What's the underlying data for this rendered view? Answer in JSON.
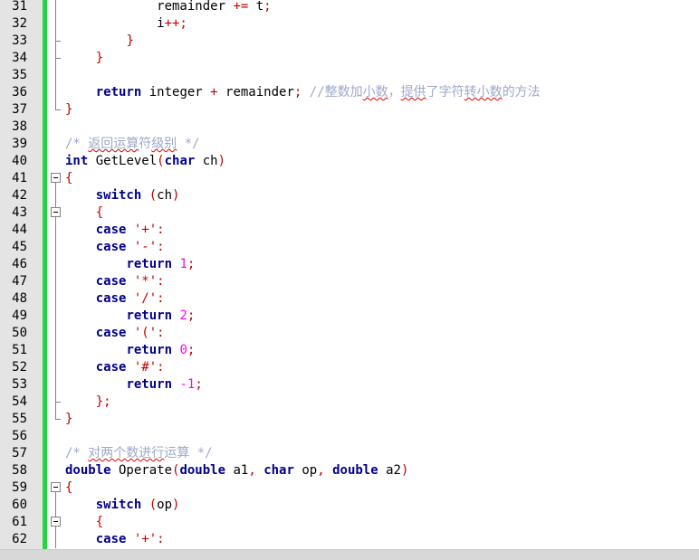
{
  "colors": {
    "gutter_bg": "#e4e4e4",
    "change_bar": "#22d63c",
    "keyword": "#00008b",
    "number": "#ff00ff",
    "string": "#c00000",
    "operator": "#c00000",
    "comment": "#9ea8c8"
  },
  "lines": [
    {
      "num": "31",
      "fold": "line",
      "tokens": [
        {
          "t": "plain",
          "v": "            remainder "
        },
        {
          "t": "operator",
          "v": "+="
        },
        {
          "t": "plain",
          "v": " t"
        },
        {
          "t": "operator",
          "v": ";"
        }
      ]
    },
    {
      "num": "32",
      "fold": "line",
      "tokens": [
        {
          "t": "plain",
          "v": "            i"
        },
        {
          "t": "operator",
          "v": "++;"
        }
      ]
    },
    {
      "num": "33",
      "fold": "end",
      "tokens": [
        {
          "t": "plain",
          "v": "        "
        },
        {
          "t": "operator",
          "v": "}"
        }
      ]
    },
    {
      "num": "34",
      "fold": "end",
      "tokens": [
        {
          "t": "plain",
          "v": "    "
        },
        {
          "t": "operator",
          "v": "}"
        }
      ]
    },
    {
      "num": "35",
      "fold": "line",
      "tokens": []
    },
    {
      "num": "36",
      "fold": "line",
      "tokens": [
        {
          "t": "plain",
          "v": "    "
        },
        {
          "t": "keyword",
          "v": "return"
        },
        {
          "t": "plain",
          "v": " integer "
        },
        {
          "t": "operator",
          "v": "+"
        },
        {
          "t": "plain",
          "v": " remainder"
        },
        {
          "t": "operator",
          "v": ";"
        },
        {
          "t": "plain",
          "v": " "
        },
        {
          "t": "comment",
          "v": "//整数加"
        },
        {
          "t": "squiggle",
          "v": "小数"
        },
        {
          "t": "comment",
          "v": "，"
        },
        {
          "t": "squiggle",
          "v": "提供"
        },
        {
          "t": "comment",
          "v": "了字符"
        },
        {
          "t": "squiggle",
          "v": "转小数"
        },
        {
          "t": "comment",
          "v": "的方法"
        }
      ]
    },
    {
      "num": "37",
      "fold": "last",
      "tokens": [
        {
          "t": "operator",
          "v": "}"
        }
      ]
    },
    {
      "num": "38",
      "fold": "none",
      "tokens": []
    },
    {
      "num": "39",
      "fold": "none",
      "tokens": [
        {
          "t": "comment",
          "v": "/* "
        },
        {
          "t": "squiggle",
          "v": "返回运算"
        },
        {
          "t": "comment",
          "v": "符"
        },
        {
          "t": "squiggle",
          "v": "级别"
        },
        {
          "t": "comment",
          "v": " */"
        }
      ]
    },
    {
      "num": "40",
      "fold": "none",
      "tokens": [
        {
          "t": "keyword",
          "v": "int"
        },
        {
          "t": "plain",
          "v": " GetLevel"
        },
        {
          "t": "operator",
          "v": "("
        },
        {
          "t": "keyword",
          "v": "char"
        },
        {
          "t": "plain",
          "v": " ch"
        },
        {
          "t": "operator",
          "v": ")"
        }
      ]
    },
    {
      "num": "41",
      "fold": "open",
      "tokens": [
        {
          "t": "operator",
          "v": "{"
        }
      ]
    },
    {
      "num": "42",
      "fold": "line",
      "tokens": [
        {
          "t": "plain",
          "v": "    "
        },
        {
          "t": "keyword",
          "v": "switch"
        },
        {
          "t": "plain",
          "v": " "
        },
        {
          "t": "operator",
          "v": "("
        },
        {
          "t": "plain",
          "v": "ch"
        },
        {
          "t": "operator",
          "v": ")"
        }
      ]
    },
    {
      "num": "43",
      "fold": "open-inner",
      "tokens": [
        {
          "t": "plain",
          "v": "    "
        },
        {
          "t": "operator",
          "v": "{"
        }
      ]
    },
    {
      "num": "44",
      "fold": "line",
      "tokens": [
        {
          "t": "plain",
          "v": "    "
        },
        {
          "t": "keyword",
          "v": "case"
        },
        {
          "t": "plain",
          "v": " "
        },
        {
          "t": "string",
          "v": "'+'"
        },
        {
          "t": "operator",
          "v": ":"
        }
      ]
    },
    {
      "num": "45",
      "fold": "line",
      "tokens": [
        {
          "t": "plain",
          "v": "    "
        },
        {
          "t": "keyword",
          "v": "case"
        },
        {
          "t": "plain",
          "v": " "
        },
        {
          "t": "string",
          "v": "'-'"
        },
        {
          "t": "operator",
          "v": ":"
        }
      ]
    },
    {
      "num": "46",
      "fold": "line",
      "tokens": [
        {
          "t": "plain",
          "v": "        "
        },
        {
          "t": "keyword",
          "v": "return"
        },
        {
          "t": "plain",
          "v": " "
        },
        {
          "t": "number",
          "v": "1"
        },
        {
          "t": "operator",
          "v": ";"
        }
      ]
    },
    {
      "num": "47",
      "fold": "line",
      "tokens": [
        {
          "t": "plain",
          "v": "    "
        },
        {
          "t": "keyword",
          "v": "case"
        },
        {
          "t": "plain",
          "v": " "
        },
        {
          "t": "string",
          "v": "'*'"
        },
        {
          "t": "operator",
          "v": ":"
        }
      ]
    },
    {
      "num": "48",
      "fold": "line",
      "tokens": [
        {
          "t": "plain",
          "v": "    "
        },
        {
          "t": "keyword",
          "v": "case"
        },
        {
          "t": "plain",
          "v": " "
        },
        {
          "t": "string",
          "v": "'/'"
        },
        {
          "t": "operator",
          "v": ":"
        }
      ]
    },
    {
      "num": "49",
      "fold": "line",
      "tokens": [
        {
          "t": "plain",
          "v": "        "
        },
        {
          "t": "keyword",
          "v": "return"
        },
        {
          "t": "plain",
          "v": " "
        },
        {
          "t": "number",
          "v": "2"
        },
        {
          "t": "operator",
          "v": ";"
        }
      ]
    },
    {
      "num": "50",
      "fold": "line",
      "tokens": [
        {
          "t": "plain",
          "v": "    "
        },
        {
          "t": "keyword",
          "v": "case"
        },
        {
          "t": "plain",
          "v": " "
        },
        {
          "t": "string",
          "v": "'('"
        },
        {
          "t": "operator",
          "v": ":"
        }
      ]
    },
    {
      "num": "51",
      "fold": "line",
      "tokens": [
        {
          "t": "plain",
          "v": "        "
        },
        {
          "t": "keyword",
          "v": "return"
        },
        {
          "t": "plain",
          "v": " "
        },
        {
          "t": "number",
          "v": "0"
        },
        {
          "t": "operator",
          "v": ";"
        }
      ]
    },
    {
      "num": "52",
      "fold": "line",
      "tokens": [
        {
          "t": "plain",
          "v": "    "
        },
        {
          "t": "keyword",
          "v": "case"
        },
        {
          "t": "plain",
          "v": " "
        },
        {
          "t": "string",
          "v": "'#'"
        },
        {
          "t": "operator",
          "v": ":"
        }
      ]
    },
    {
      "num": "53",
      "fold": "line",
      "tokens": [
        {
          "t": "plain",
          "v": "        "
        },
        {
          "t": "keyword",
          "v": "return"
        },
        {
          "t": "plain",
          "v": " "
        },
        {
          "t": "number",
          "v": "-1"
        },
        {
          "t": "operator",
          "v": ";"
        }
      ]
    },
    {
      "num": "54",
      "fold": "end",
      "tokens": [
        {
          "t": "plain",
          "v": "    "
        },
        {
          "t": "operator",
          "v": "};"
        }
      ]
    },
    {
      "num": "55",
      "fold": "last",
      "tokens": [
        {
          "t": "operator",
          "v": "}"
        }
      ]
    },
    {
      "num": "56",
      "fold": "none",
      "tokens": []
    },
    {
      "num": "57",
      "fold": "none",
      "tokens": [
        {
          "t": "comment",
          "v": "/* "
        },
        {
          "t": "squiggle",
          "v": "对两个数进行"
        },
        {
          "t": "comment",
          "v": "运算 */"
        }
      ]
    },
    {
      "num": "58",
      "fold": "none",
      "tokens": [
        {
          "t": "keyword",
          "v": "double"
        },
        {
          "t": "plain",
          "v": " Operate"
        },
        {
          "t": "operator",
          "v": "("
        },
        {
          "t": "keyword",
          "v": "double"
        },
        {
          "t": "plain",
          "v": " a1"
        },
        {
          "t": "operator",
          "v": ","
        },
        {
          "t": "plain",
          "v": " "
        },
        {
          "t": "keyword",
          "v": "char"
        },
        {
          "t": "plain",
          "v": " op"
        },
        {
          "t": "operator",
          "v": ","
        },
        {
          "t": "plain",
          "v": " "
        },
        {
          "t": "keyword",
          "v": "double"
        },
        {
          "t": "plain",
          "v": " a2"
        },
        {
          "t": "operator",
          "v": ")"
        }
      ]
    },
    {
      "num": "59",
      "fold": "open",
      "tokens": [
        {
          "t": "operator",
          "v": "{"
        }
      ]
    },
    {
      "num": "60",
      "fold": "line",
      "tokens": [
        {
          "t": "plain",
          "v": "    "
        },
        {
          "t": "keyword",
          "v": "switch"
        },
        {
          "t": "plain",
          "v": " "
        },
        {
          "t": "operator",
          "v": "("
        },
        {
          "t": "plain",
          "v": "op"
        },
        {
          "t": "operator",
          "v": ")"
        }
      ]
    },
    {
      "num": "61",
      "fold": "open-inner",
      "tokens": [
        {
          "t": "plain",
          "v": "    "
        },
        {
          "t": "operator",
          "v": "{"
        }
      ]
    },
    {
      "num": "62",
      "fold": "line",
      "tokens": [
        {
          "t": "plain",
          "v": "    "
        },
        {
          "t": "keyword",
          "v": "case"
        },
        {
          "t": "plain",
          "v": " "
        },
        {
          "t": "string",
          "v": "'+'"
        },
        {
          "t": "operator",
          "v": ":"
        }
      ]
    }
  ]
}
